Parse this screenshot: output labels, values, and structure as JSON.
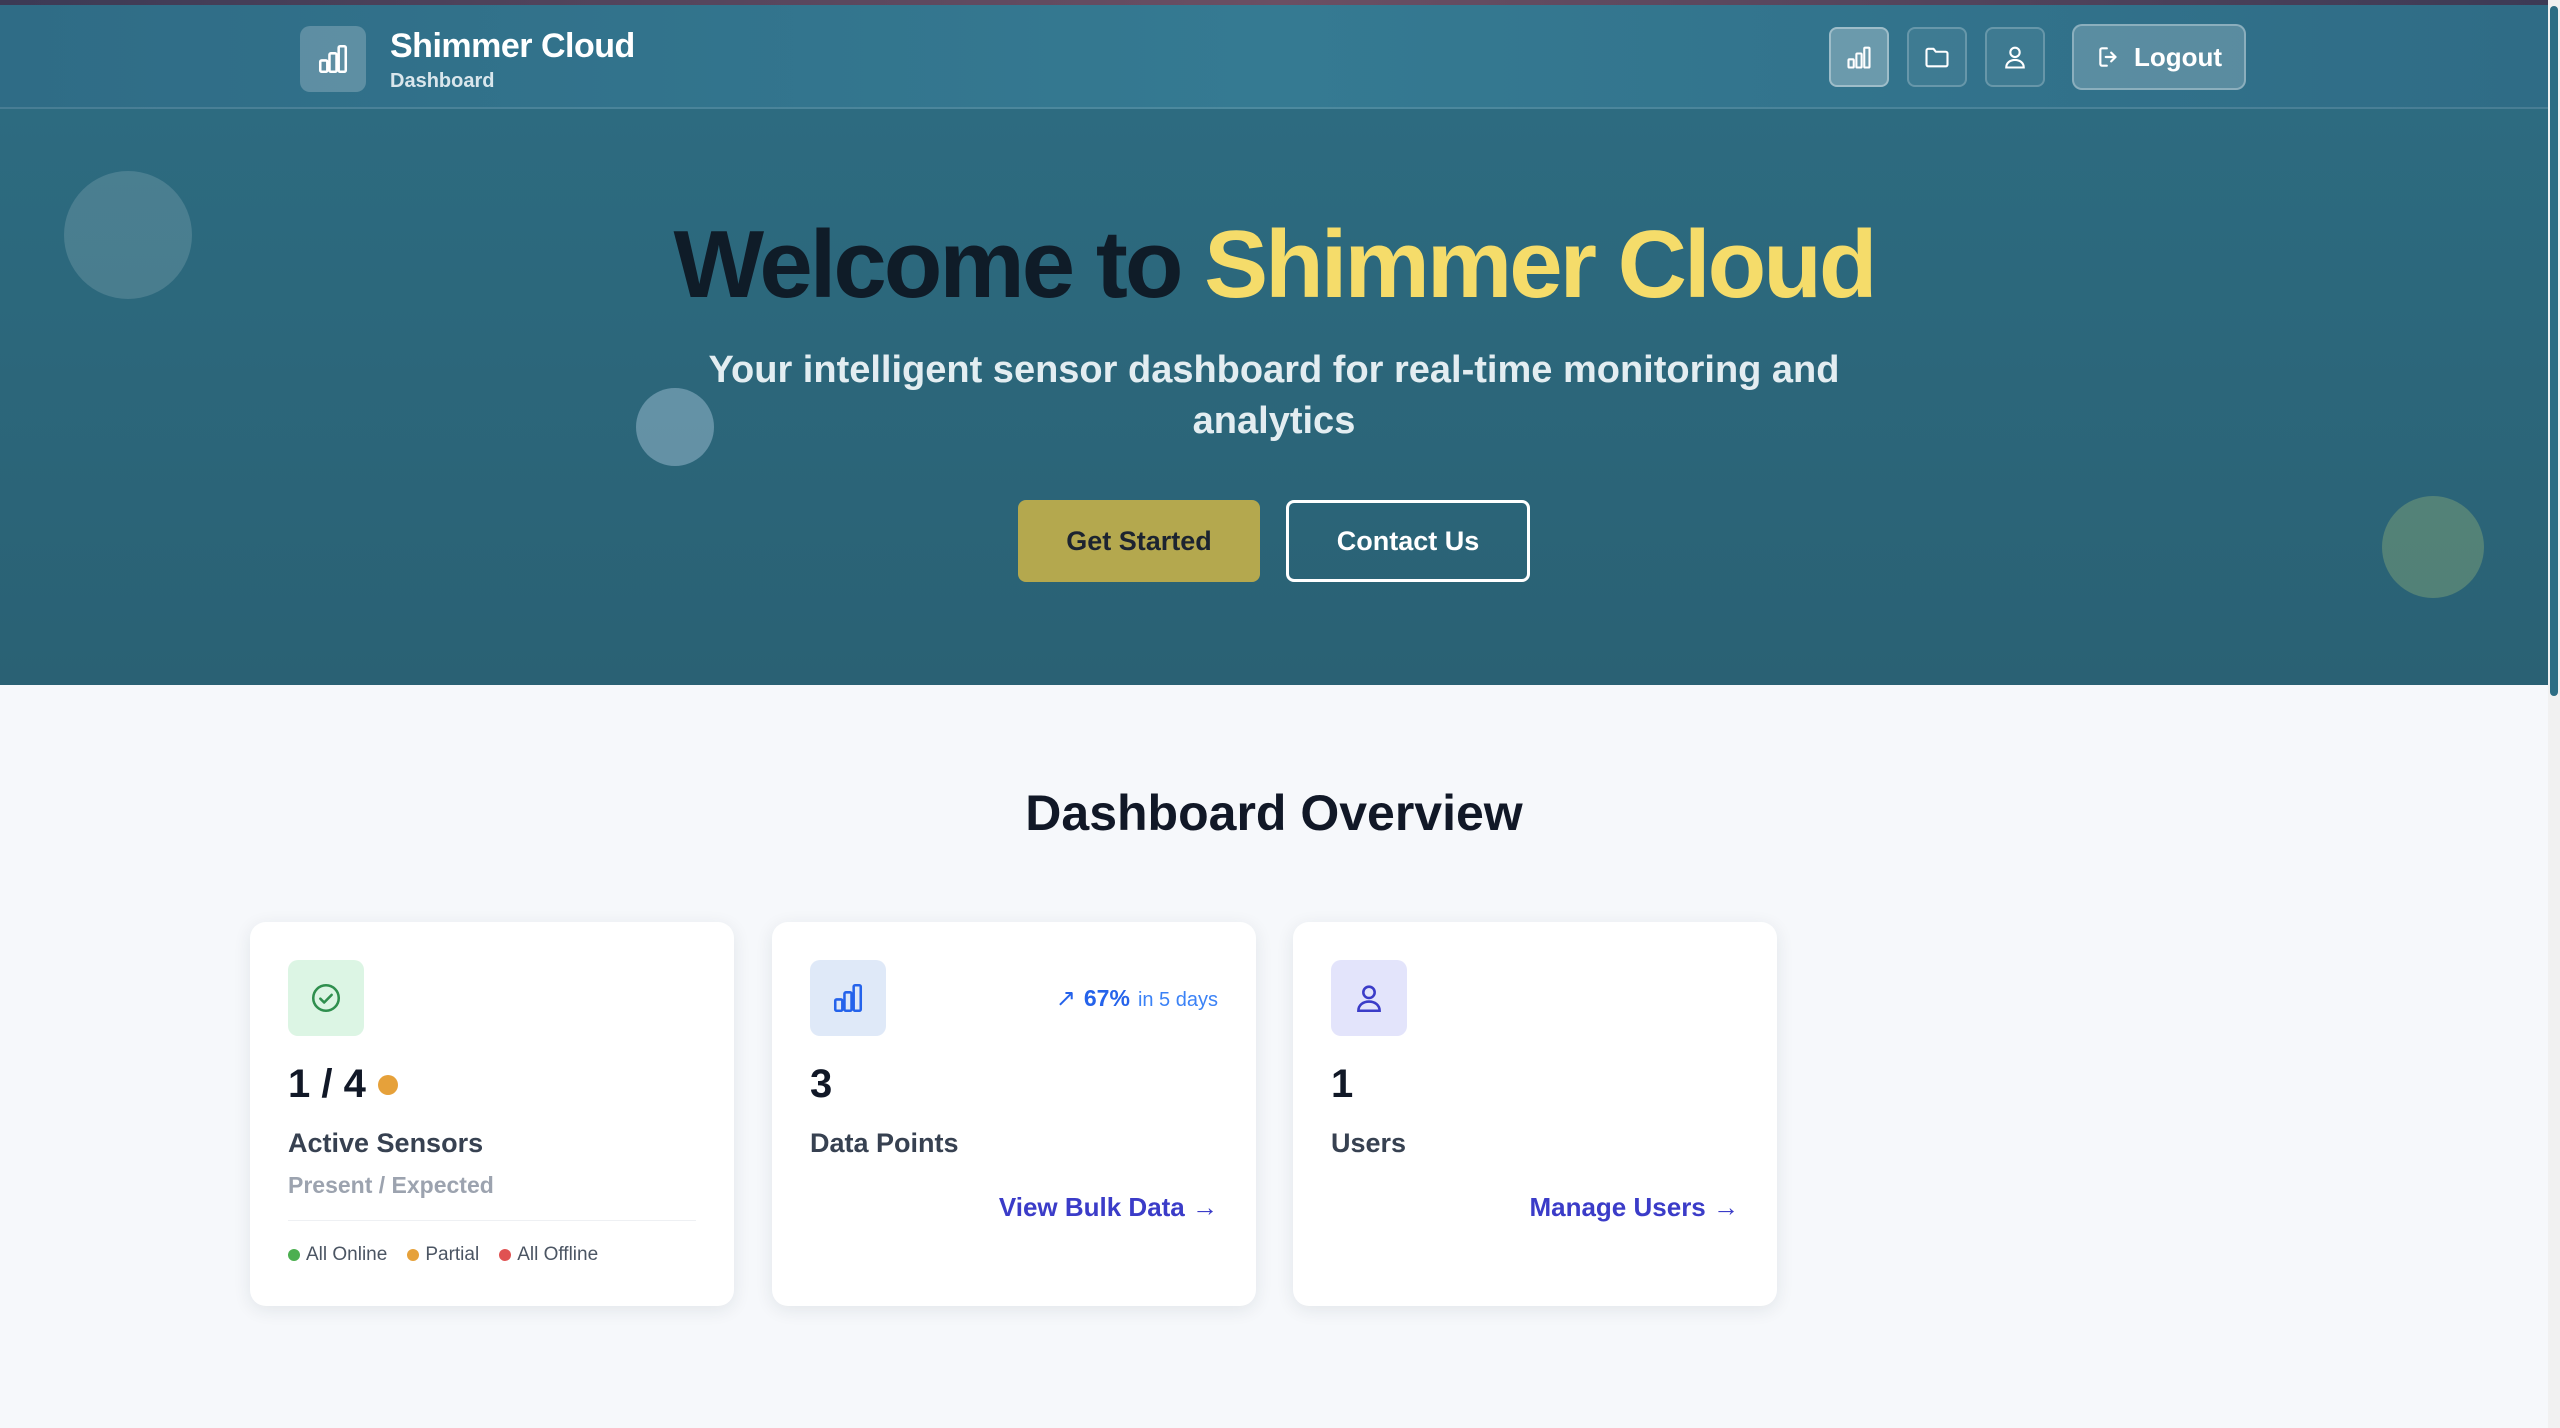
{
  "header": {
    "brand_title": "Shimmer Cloud",
    "brand_subtitle": "Dashboard",
    "nav": [
      {
        "name": "dashboard",
        "icon": "bar-chart-icon",
        "active": true
      },
      {
        "name": "files",
        "icon": "folder-icon",
        "active": false
      },
      {
        "name": "profile",
        "icon": "user-icon",
        "active": false
      }
    ],
    "logout_label": "Logout"
  },
  "hero": {
    "title_part1": "Welcome to",
    "title_part2": "Shimmer Cloud",
    "subtitle": "Your intelligent sensor dashboard for real-time monitoring and analytics",
    "primary_cta": "Get Started",
    "secondary_cta": "Contact Us"
  },
  "overview": {
    "title": "Dashboard Overview",
    "cards": [
      {
        "icon": "check-circle-icon",
        "value": "1 / 4",
        "status_color": "#e6a13a",
        "label": "Active Sensors",
        "sublabel": "Present / Expected",
        "legend": [
          {
            "label": "All Online",
            "color": "#4caf50"
          },
          {
            "label": "Partial",
            "color": "#e6a13a"
          },
          {
            "label": "All Offline",
            "color": "#e05252"
          }
        ]
      },
      {
        "icon": "bar-chart-icon",
        "value": "3",
        "label": "Data Points",
        "trend_arrow": "↗",
        "trend_percent": "67%",
        "trend_note": "in 5 days",
        "link": "View Bulk Data →"
      },
      {
        "icon": "user-icon",
        "value": "1",
        "label": "Users",
        "link": "Manage Users →"
      }
    ]
  },
  "colors": {
    "header_bg": "#357a92",
    "hero_bg": "#2d6b80",
    "accent_yellow": "#f5dc6a",
    "cta_gold": "#b4a84e",
    "link_indigo": "#3b3cc8"
  }
}
